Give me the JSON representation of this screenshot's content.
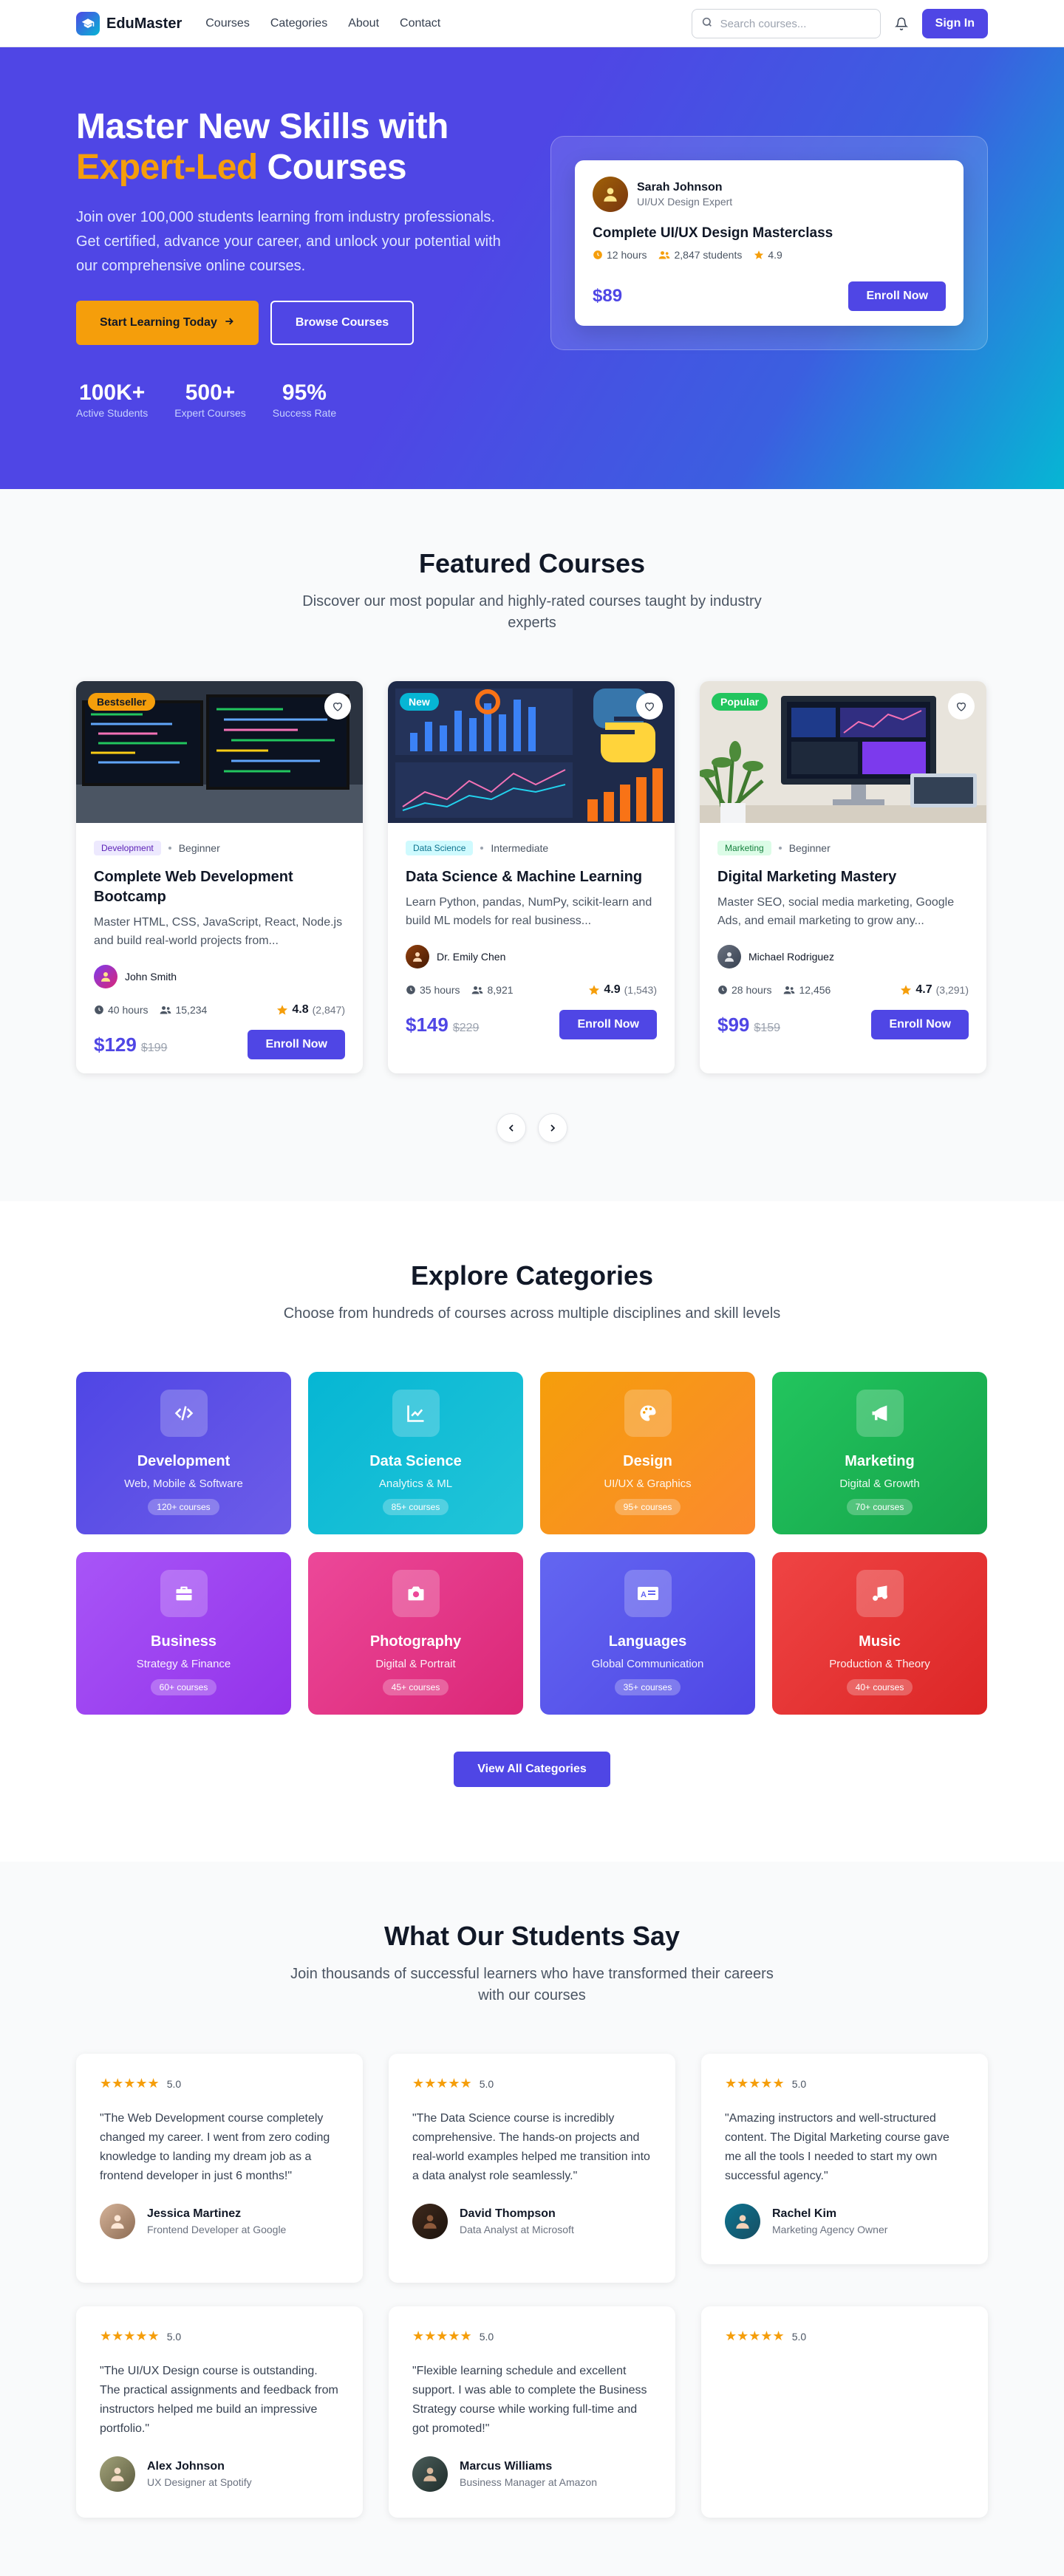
{
  "nav": {
    "brand": "EduMaster",
    "links": [
      "Courses",
      "Categories",
      "About",
      "Contact"
    ],
    "search_placeholder": "Search courses...",
    "signin": "Sign In"
  },
  "hero": {
    "title_line1": "Master New Skills with",
    "title_accent": "Expert-Led",
    "title_end": " Courses",
    "subtitle": "Join over 100,000 students learning from industry professionals. Get certified, advance your career, and unlock your potential with our comprehensive online courses.",
    "cta_primary": "Start Learning Today",
    "cta_secondary": "Browse Courses",
    "stats": [
      {
        "num": "100K+",
        "label": "Active Students"
      },
      {
        "num": "500+",
        "label": "Expert Courses"
      },
      {
        "num": "95%",
        "label": "Success Rate"
      }
    ],
    "preview": {
      "instructor": "Sarah Johnson",
      "role": "UI/UX Design Expert",
      "course": "Complete UI/UX Design Masterclass",
      "hours": "12 hours",
      "students": "2,847 students",
      "rating": "4.9",
      "price": "$89",
      "enroll": "Enroll Now"
    }
  },
  "featured": {
    "title": "Featured Courses",
    "subtitle": "Discover our most popular and highly-rated courses taught by industry experts",
    "courses": [
      {
        "badge": "Bestseller",
        "tag": "Development",
        "level": "Beginner",
        "title": "Complete Web Development Bootcamp",
        "desc": "Master HTML, CSS, JavaScript, React, Node.js and build real-world projects from...",
        "instructor": "John Smith",
        "hours": "40 hours",
        "students": "15,234",
        "rating": "4.8",
        "reviews": "(2,847)",
        "price": "$129",
        "old_price": "$199",
        "enroll": "Enroll Now"
      },
      {
        "badge": "New",
        "tag": "Data Science",
        "level": "Intermediate",
        "title": "Data Science & Machine Learning",
        "desc": "Learn Python, pandas, NumPy, scikit-learn and build ML models for real business...",
        "instructor": "Dr. Emily Chen",
        "hours": "35 hours",
        "students": "8,921",
        "rating": "4.9",
        "reviews": "(1,543)",
        "price": "$149",
        "old_price": "$229",
        "enroll": "Enroll Now"
      },
      {
        "badge": "Popular",
        "tag": "Marketing",
        "level": "Beginner",
        "title": "Digital Marketing Mastery",
        "desc": "Master SEO, social media marketing, Google Ads, and email marketing to grow any...",
        "instructor": "Michael Rodriguez",
        "hours": "28 hours",
        "students": "12,456",
        "rating": "4.7",
        "reviews": "(3,291)",
        "price": "$99",
        "old_price": "$159",
        "enroll": "Enroll Now"
      }
    ]
  },
  "categories": {
    "title": "Explore Categories",
    "subtitle": "Choose from hundreds of courses across multiple disciplines and skill levels",
    "items": [
      {
        "name": "Development",
        "desc": "Web, Mobile & Software",
        "count": "120+ courses",
        "color": "#5b4fe0"
      },
      {
        "name": "Data Science",
        "desc": "Analytics & ML",
        "count": "85+ courses",
        "color": "#14b8c9"
      },
      {
        "name": "Design",
        "desc": "UI/UX & Graphics",
        "count": "95+ courses",
        "color": "#f7941d"
      },
      {
        "name": "Marketing",
        "desc": "Digital & Growth",
        "count": "70+ courses",
        "color": "#22b856"
      },
      {
        "name": "Business",
        "desc": "Strategy & Finance",
        "count": "60+ courses",
        "color": "#9b45e4"
      },
      {
        "name": "Photography",
        "desc": "Digital & Portrait",
        "count": "45+ courses",
        "color": "#e63f8c"
      },
      {
        "name": "Languages",
        "desc": "Global Communication",
        "count": "35+ courses",
        "color": "#5a55e8"
      },
      {
        "name": "Music",
        "desc": "Production & Theory",
        "count": "40+ courses",
        "color": "#e53935"
      }
    ],
    "view_all": "View All Categories"
  },
  "testimonials": {
    "title": "What Our Students Say",
    "subtitle": "Join thousands of successful learners who have transformed their careers with our courses",
    "items": [
      {
        "rating": "5.0",
        "quote": "\"The Web Development course completely changed my career. I went from zero coding knowledge to landing my dream job as a frontend developer in just 6 months!\"",
        "name": "Jessica Martinez",
        "role": "Frontend Developer at Google"
      },
      {
        "rating": "5.0",
        "quote": "\"The Data Science course is incredibly comprehensive. The hands-on projects and real-world examples helped me transition into a data analyst role seamlessly.\"",
        "name": "David Thompson",
        "role": "Data Analyst at Microsoft"
      },
      {
        "rating": "5.0",
        "quote": "\"Amazing instructors and well-structured content. The Digital Marketing course gave me all the tools I needed to start my own successful agency.\"",
        "name": "Rachel Kim",
        "role": "Marketing Agency Owner"
      },
      {
        "rating": "5.0",
        "quote": "\"The UI/UX Design course is outstanding. The practical assignments and feedback from instructors helped me build an impressive portfolio.\"",
        "name": "Alex Johnson",
        "role": "UX Designer at Spotify"
      },
      {
        "rating": "5.0",
        "quote": "\"Flexible learning schedule and excellent support. I was able to complete the Business Strategy course while working full-time and got promoted!\"",
        "name": "Marcus Williams",
        "role": "Business Manager at Amazon"
      },
      {
        "rating": "5.0"
      }
    ]
  },
  "colors": {
    "primary": "#4f46e5",
    "accent": "#f59e0b",
    "teal": "#06b6d4",
    "star": "#f59e0b"
  }
}
